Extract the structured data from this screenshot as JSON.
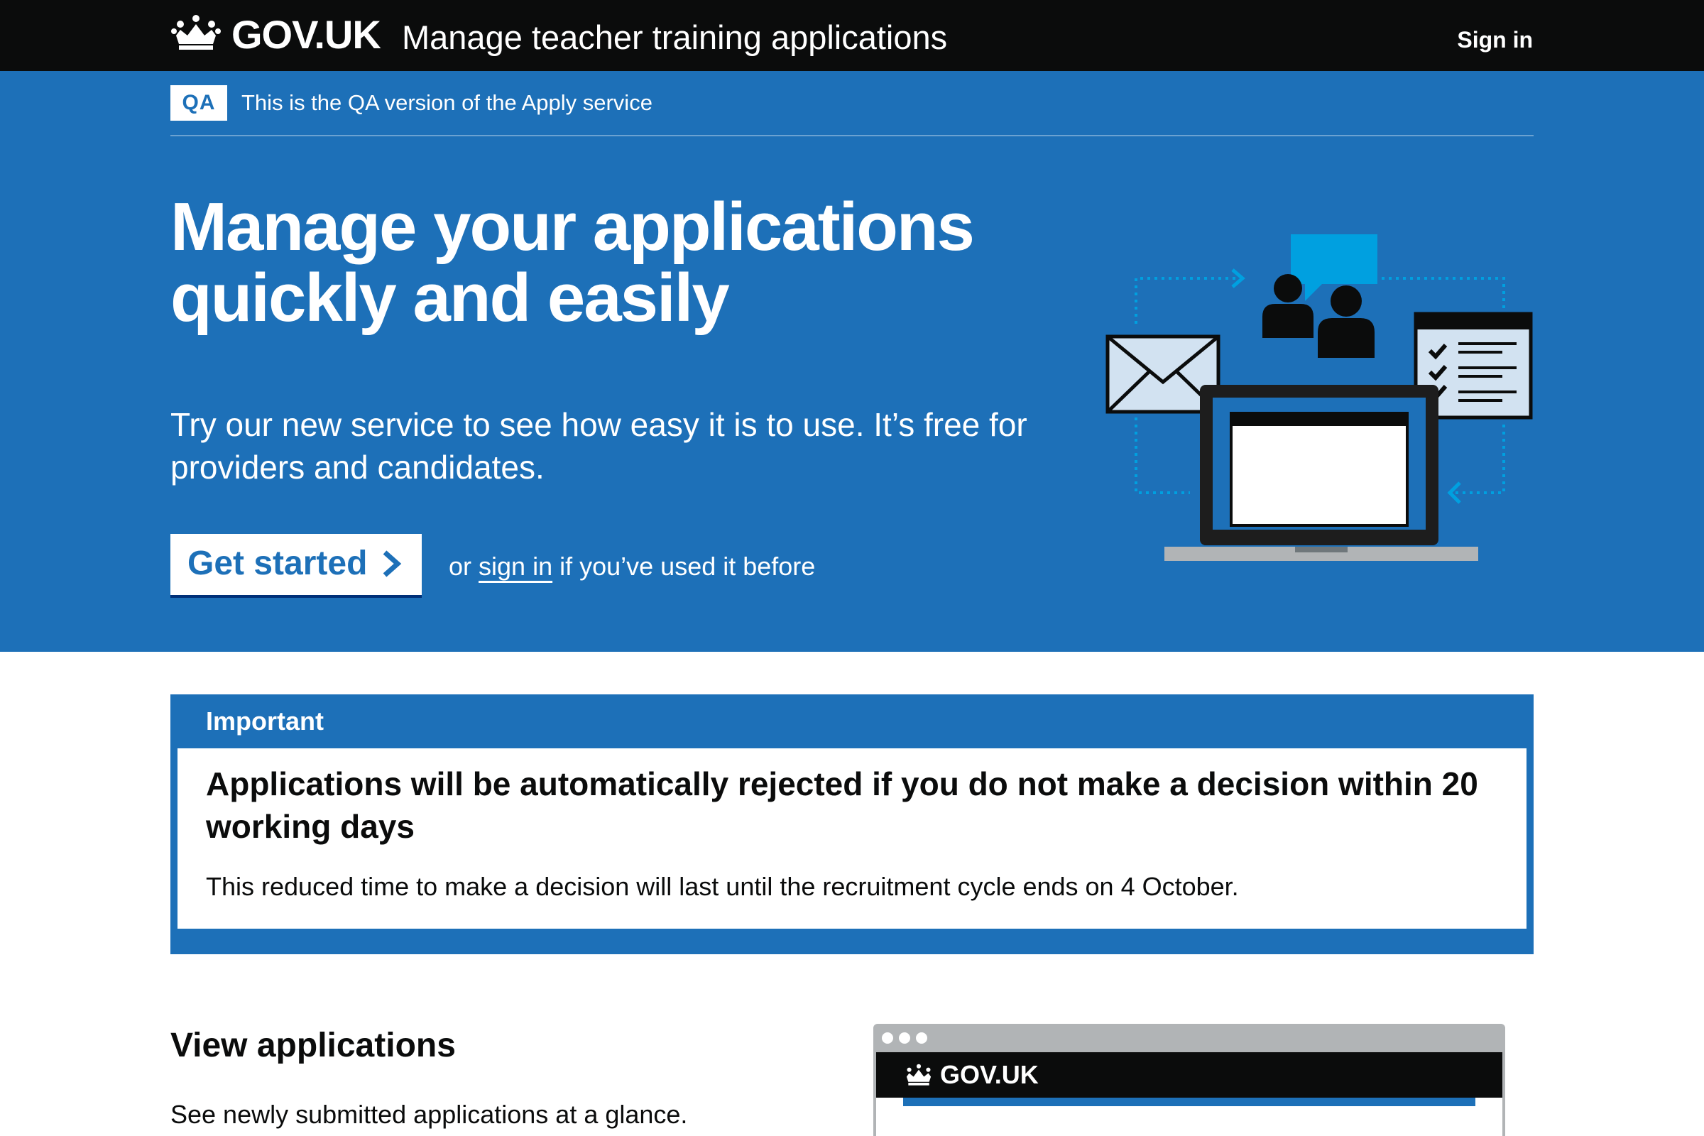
{
  "header": {
    "logo_text": "GOV.UK",
    "service_name": "Manage teacher training applications",
    "sign_in": "Sign in"
  },
  "phase_banner": {
    "tag": "QA",
    "text": "This is the QA version of the Apply service"
  },
  "hero": {
    "title_line1": "Manage your applications",
    "title_line2": "quickly and easily",
    "lede": "Try our new service to see how easy it is to use. It’s free for providers and candidates.",
    "start_button": "Get started",
    "or_prefix": "or",
    "sign_in_link": "sign in",
    "or_suffix": "if you’ve used it before"
  },
  "notification": {
    "title": "Important",
    "heading": "Applications will be automatically rejected if you do not make a decision within 20 working days",
    "body": "This reduced time to make a decision will last until the recruitment cycle ends on 4 October."
  },
  "section": {
    "heading": "View applications",
    "text": "See newly submitted applications at a glance."
  },
  "preview": {
    "logo_text": "GOV.UK"
  },
  "colors": {
    "header_bg": "#0b0c0c",
    "brand_blue": "#1d70b8",
    "text": "#0b0c0c",
    "white": "#ffffff",
    "illustration_light_blue": "#00a0e0"
  },
  "icons": [
    "crown-icon",
    "chevron-right-icon",
    "envelope-icon",
    "people-icon",
    "speech-bubble-icon",
    "checklist-icon",
    "laptop-icon"
  ]
}
